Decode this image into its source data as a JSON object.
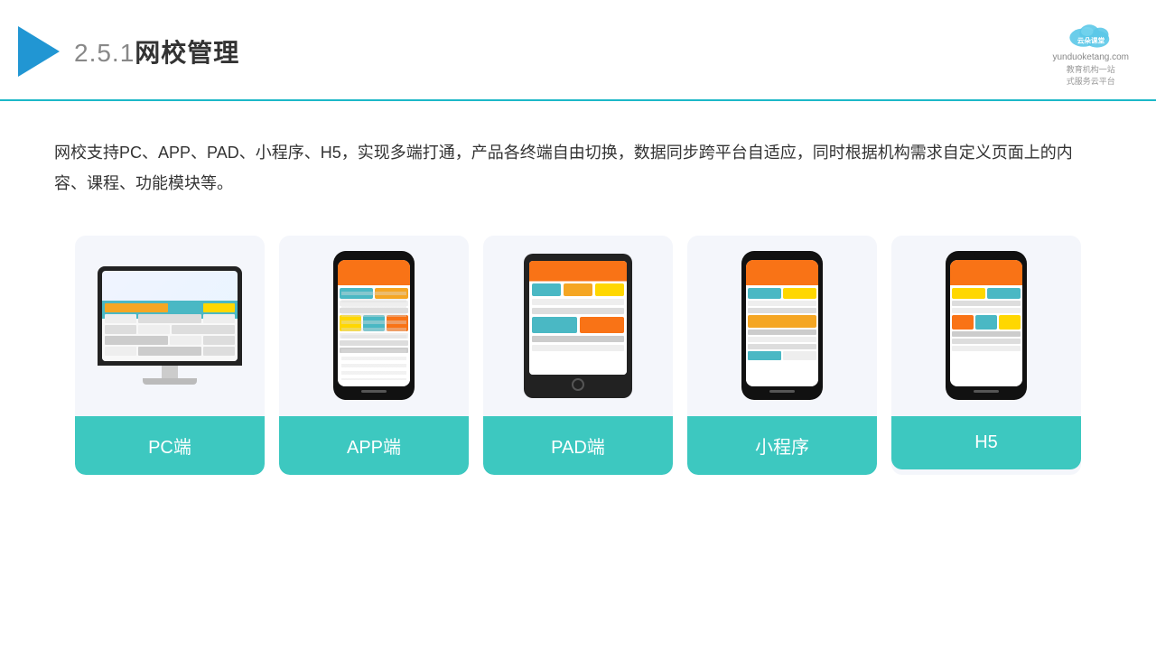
{
  "header": {
    "section_number": "2.5.1",
    "title": "网校管理",
    "logo_name": "云朵课堂",
    "logo_url": "yunduoketang.com",
    "logo_slogan": "教育机构一站\n式服务云平台"
  },
  "description": {
    "text": "网校支持PC、APP、PAD、小程序、H5，实现多端打通，产品各终端自由切换，数据同步跨平台自适应，同时根据机构需求自定义页面上的内容、课程、功能模块等。"
  },
  "cards": [
    {
      "id": "pc",
      "label": "PC端"
    },
    {
      "id": "app",
      "label": "APP端"
    },
    {
      "id": "pad",
      "label": "PAD端"
    },
    {
      "id": "miniapp",
      "label": "小程序"
    },
    {
      "id": "h5",
      "label": "H5"
    }
  ],
  "colors": {
    "accent": "#3dc8c0",
    "header_border": "#1cb8c8",
    "card_bg": "#f4f6fb",
    "triangle": "#2196d3"
  }
}
